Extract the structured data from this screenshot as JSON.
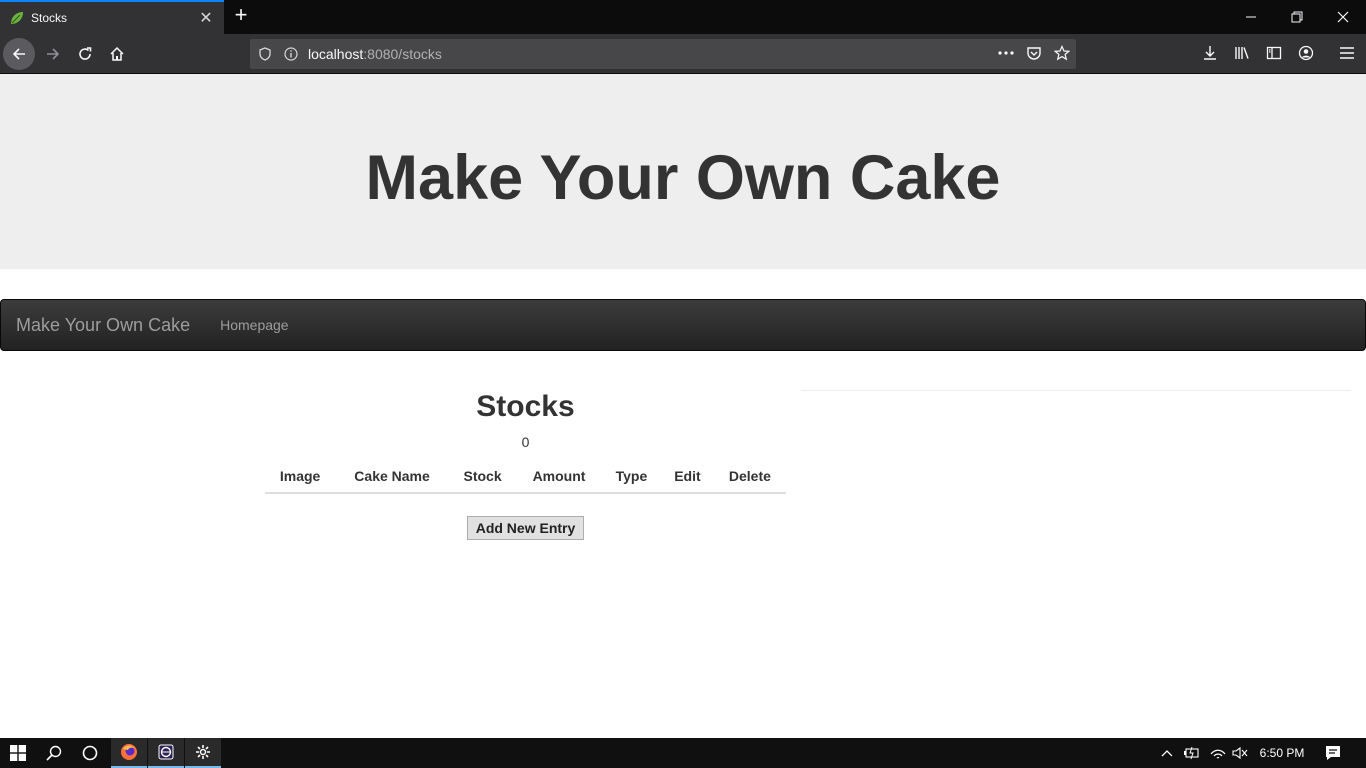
{
  "browser": {
    "tab_title": "Stocks",
    "url_host": "localhost",
    "url_path": ":8080/stocks"
  },
  "page": {
    "jumbotron_title": "Make Your Own Cake",
    "nav": {
      "brand": "Make Your Own Cake",
      "link": "Homepage"
    },
    "stocks_heading": "Stocks",
    "count": "0",
    "table_headers": [
      "Image",
      "Cake Name",
      "Stock",
      "Amount",
      "Type",
      "Edit",
      "Delete"
    ],
    "add_button": "Add New Entry"
  },
  "taskbar": {
    "clock": "6:50 PM"
  },
  "colors": {
    "jumbotron_bg": "#eeeeee",
    "navbar_bg": "#222222",
    "accent": "#0a84ff"
  }
}
